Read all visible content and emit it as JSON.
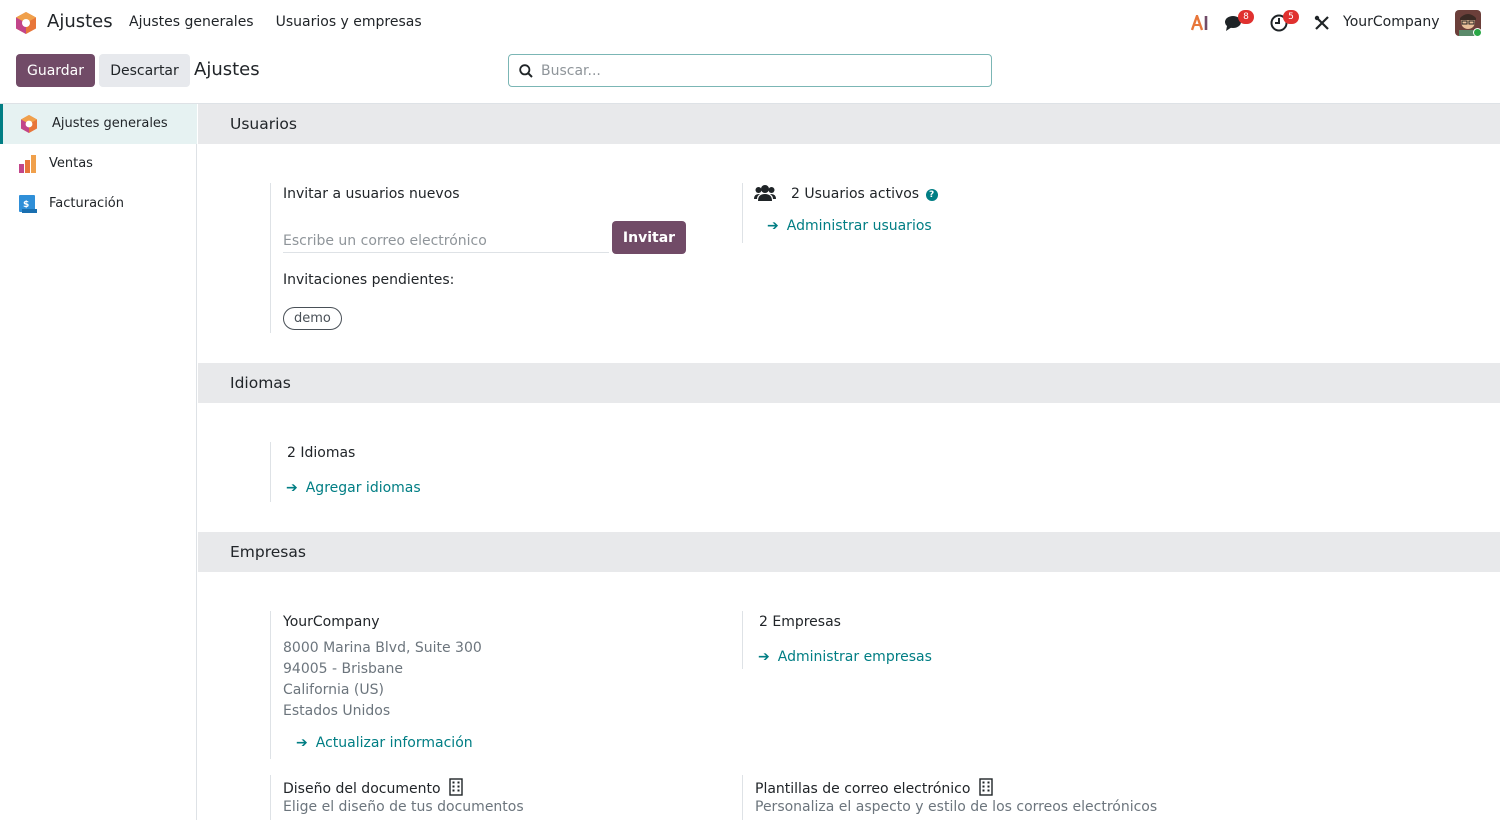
{
  "navbar": {
    "app_title": "Ajustes",
    "menu": [
      "Ajustes generales",
      "Usuarios y empresas"
    ],
    "messages_count": "8",
    "activities_count": "5",
    "company": "YourCompany"
  },
  "control_panel": {
    "save_label": "Guardar",
    "discard_label": "Descartar",
    "title": "Ajustes",
    "search_placeholder": "Buscar..."
  },
  "sidebar": {
    "items": [
      {
        "label": "Ajustes generales",
        "active": true,
        "icon": "settings-app-icon"
      },
      {
        "label": "Ventas",
        "active": false,
        "icon": "sales-app-icon"
      },
      {
        "label": "Facturación",
        "active": false,
        "icon": "invoicing-app-icon"
      }
    ]
  },
  "users_section": {
    "title": "Usuarios",
    "invite_heading": "Invitar a usuarios nuevos",
    "email_placeholder": "Escribe un correo electrónico",
    "invite_button": "Invitar",
    "pending_label": "Invitaciones pendientes:",
    "pending_tags": [
      "demo"
    ],
    "active_users": "2 Usuarios activos",
    "manage_users": "Administrar usuarios"
  },
  "languages_section": {
    "title": "Idiomas",
    "count": "2 Idiomas",
    "add_link": "Agregar idiomas"
  },
  "companies_section": {
    "title": "Empresas",
    "company_name": "YourCompany",
    "address": [
      "8000 Marina Blvd, Suite 300",
      "94005 - Brisbane",
      "California (US)",
      "Estados Unidos"
    ],
    "update_link": "Actualizar información",
    "count": "2 Empresas",
    "manage_link": "Administrar empresas",
    "doc_layout_title": "Diseño del documento",
    "doc_layout_desc": "Elige el diseño de tus documentos",
    "email_templates_title": "Plantillas de correo electrónico",
    "email_templates_desc": "Personaliza el aspecto y estilo de los correos electrónicos"
  },
  "colors": {
    "primary": "#714b67",
    "link": "#017e84",
    "badge": "#e0312f"
  }
}
